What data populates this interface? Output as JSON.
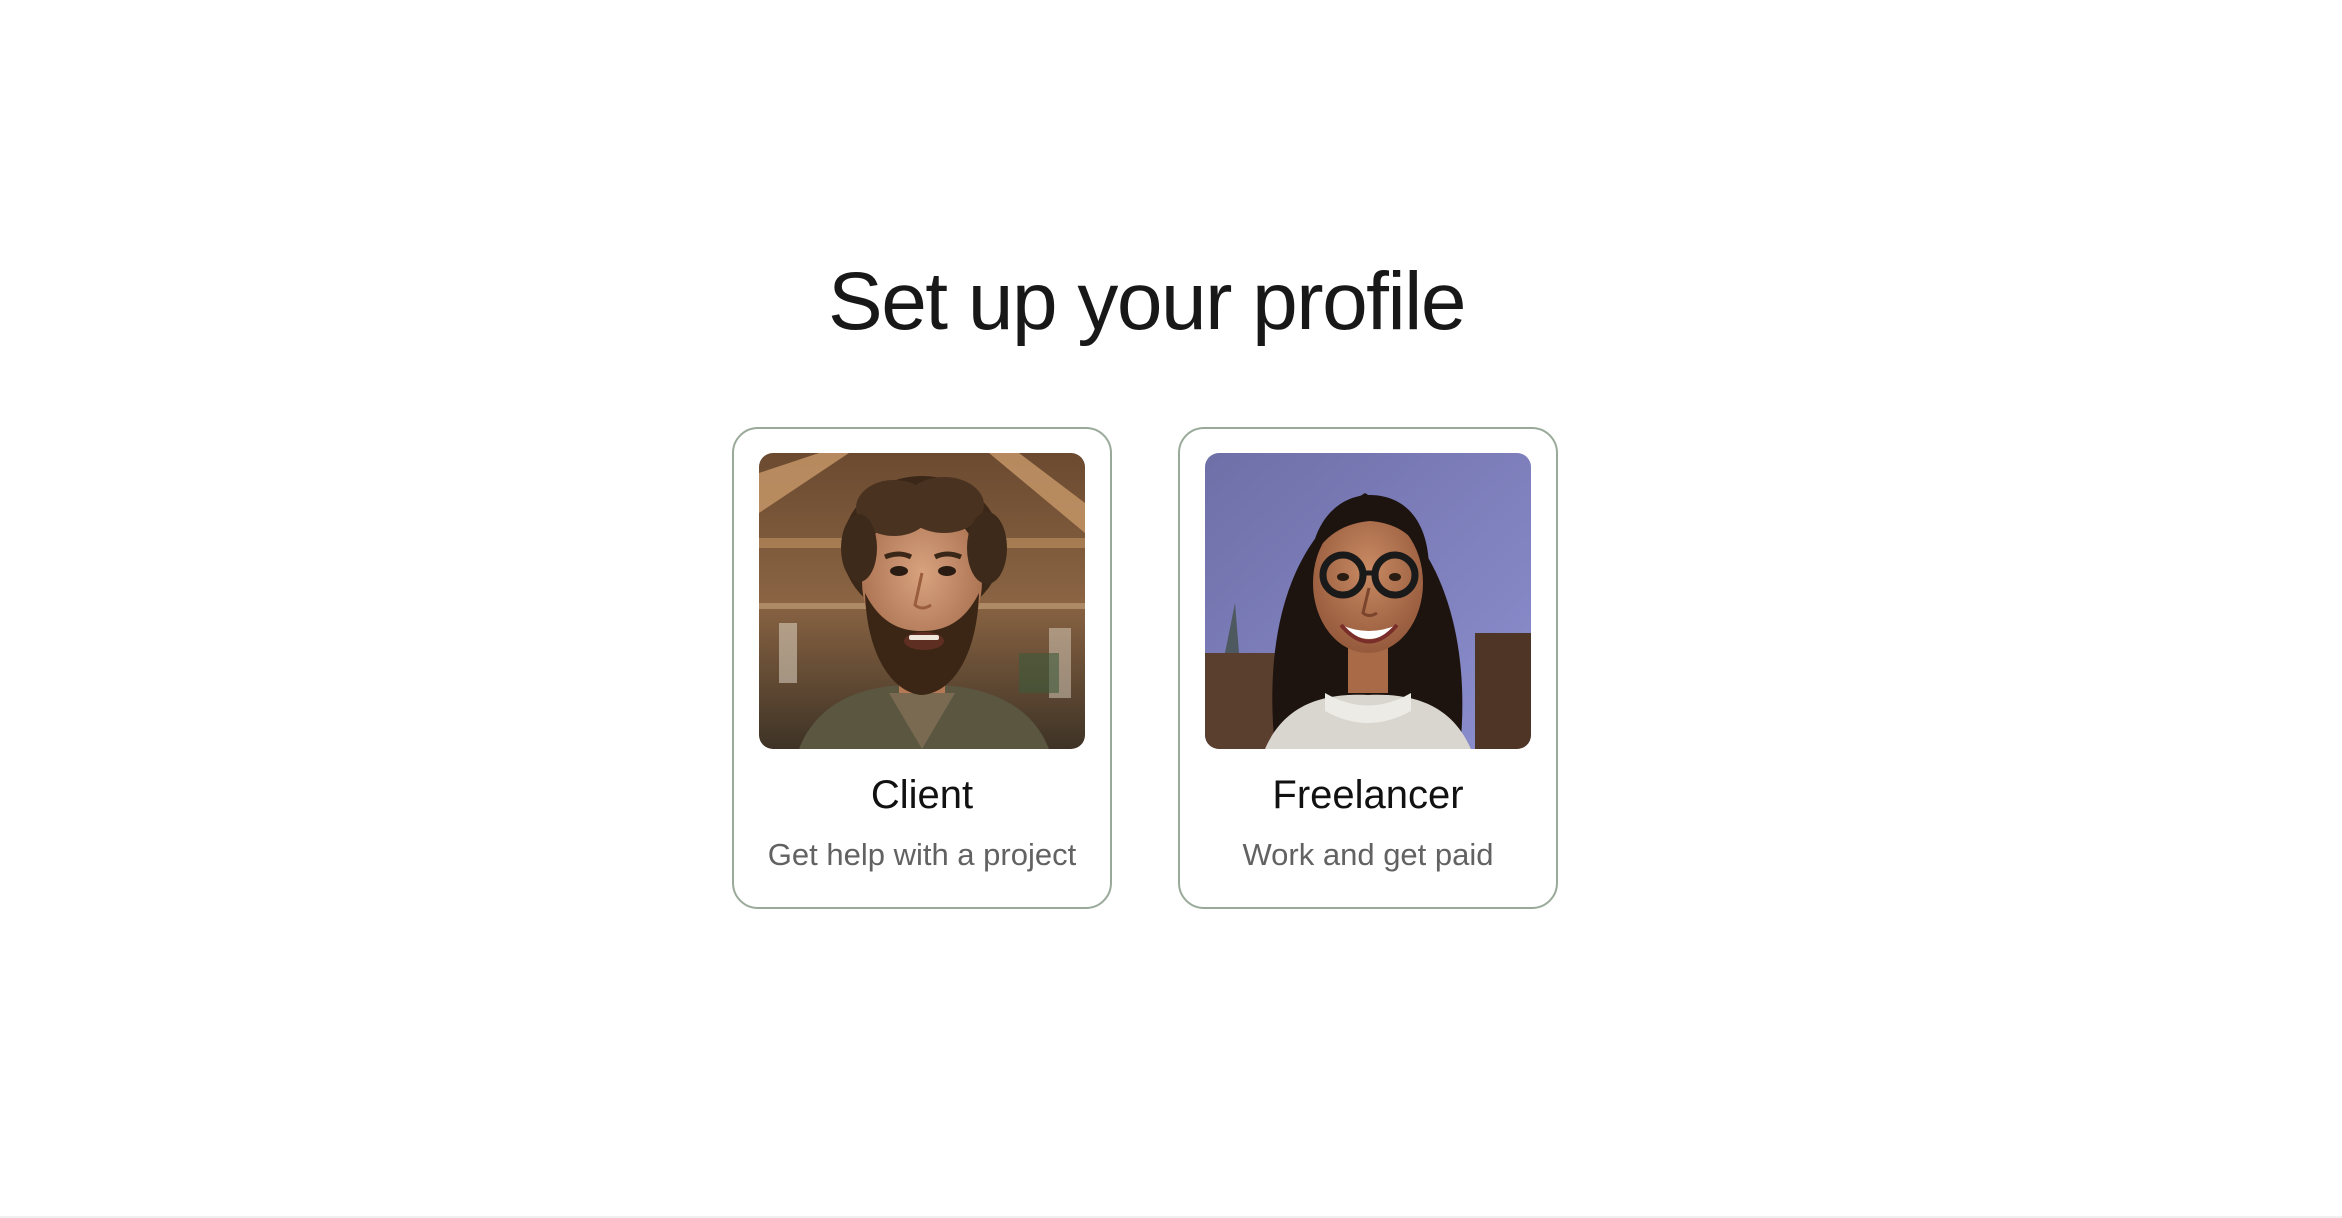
{
  "page": {
    "title": "Set up your profile"
  },
  "cards": [
    {
      "title": "Client",
      "subtitle": "Get help with a project",
      "image": "man-portrait-photo"
    },
    {
      "title": "Freelancer",
      "subtitle": "Work and get paid",
      "image": "woman-portrait-photo"
    }
  ],
  "colors": {
    "card_border": "#9aaa9a",
    "title_text": "#181818",
    "subtitle_text": "#626262",
    "background": "#ffffff"
  }
}
